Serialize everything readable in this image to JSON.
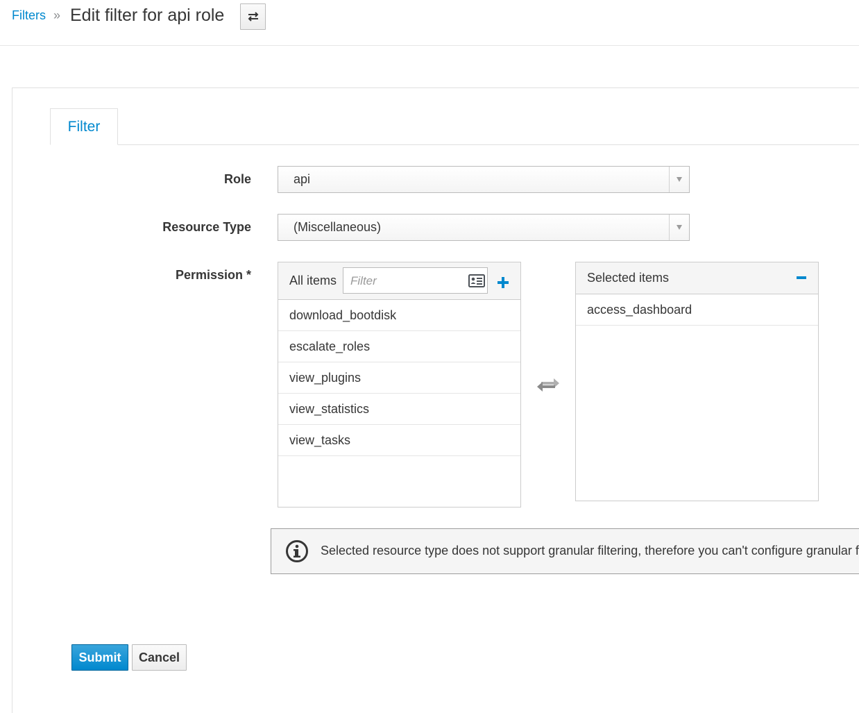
{
  "breadcrumb": {
    "parent_label": "Filters",
    "separator": "»",
    "title": "Edit filter for api role"
  },
  "header": {
    "switcher_icon": "switch-arrows-icon"
  },
  "tabs": [
    {
      "label": "Filter",
      "active": true
    }
  ],
  "form": {
    "role": {
      "label": "Role",
      "value": "api"
    },
    "resource_type": {
      "label": "Resource Type",
      "value": "(Miscellaneous)"
    },
    "permission": {
      "label": "Permission *",
      "available": {
        "header": "All items",
        "filter_placeholder": "Filter",
        "items": [
          "download_bootdisk",
          "escalate_roles",
          "view_plugins",
          "view_statistics",
          "view_tasks"
        ]
      },
      "selected": {
        "header": "Selected items",
        "items": [
          "access_dashboard"
        ]
      }
    }
  },
  "alert": {
    "icon": "info-circle-icon",
    "text": "Selected resource type does not support granular filtering, therefore you can't configure granular filter"
  },
  "actions": {
    "submit_label": "Submit",
    "cancel_label": "Cancel"
  },
  "colors": {
    "accent": "#0088ce",
    "primary_button": "#0088ce",
    "text": "#363636"
  }
}
